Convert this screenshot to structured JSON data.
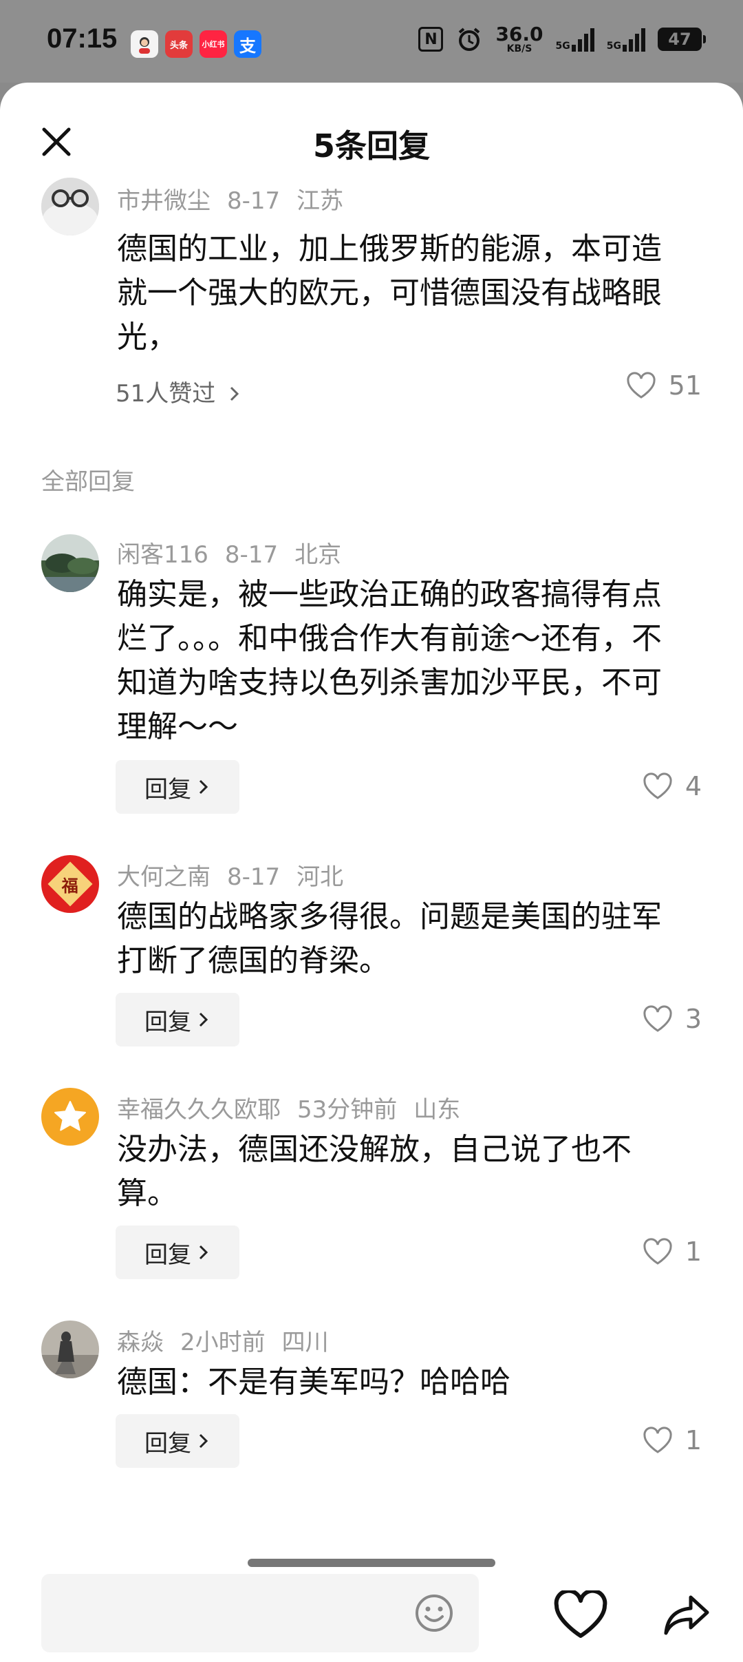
{
  "status_bar": {
    "time": "07:15",
    "apps": [
      {
        "name": "avatar-app-icon",
        "label": "",
        "color": "#f4f4f4"
      },
      {
        "name": "toutiao-app-icon",
        "label": "头条",
        "color": "#e23b3b"
      },
      {
        "name": "xiaohongshu-app-icon",
        "label": "小红书",
        "color": "#ff2442"
      },
      {
        "name": "alipay-app-icon",
        "label": "支",
        "color": "#1677ff"
      }
    ],
    "nfc": "N",
    "net_speed": "36.0",
    "net_unit": "KB/S",
    "sig1_label": "5G",
    "sig2_label": "5G",
    "battery": "47"
  },
  "sheet": {
    "title": "5条回复",
    "main_comment": {
      "user": "市井微尘",
      "date": "8-17",
      "location": "江苏",
      "text": "德国的工业，加上俄罗斯的能源，本可造就一个强大的欧元，可惜德国没有战略眼光，",
      "liked_by": "51人赞过",
      "likes": "51"
    },
    "section_label": "全部回复",
    "replies": [
      {
        "user": "闲客116",
        "date": "8-17",
        "location": "北京",
        "text": "确实是，被一些政治正确的政客搞得有点烂了。。。和中俄合作大有前途～还有，不知道为啥支持以色列杀害加沙平民，不可理解～～",
        "reply_label": "回复",
        "likes": "4"
      },
      {
        "user": "大何之南",
        "date": "8-17",
        "location": "河北",
        "text": "德国的战略家多得很。问题是美国的驻军打断了德国的脊梁。",
        "reply_label": "回复",
        "likes": "3"
      },
      {
        "user": "幸福久久久欧耶",
        "date": "53分钟前",
        "location": "山东",
        "text": "没办法，德国还没解放，自己说了也不算。",
        "reply_label": "回复",
        "likes": "1"
      },
      {
        "user": "森焱",
        "date": "2小时前",
        "location": "四川",
        "text": "德国：不是有美军吗？哈哈哈",
        "reply_label": "回复",
        "likes": "1"
      }
    ],
    "avatar_badge": "福"
  },
  "bottom_bar": {
    "input_placeholder": ""
  }
}
